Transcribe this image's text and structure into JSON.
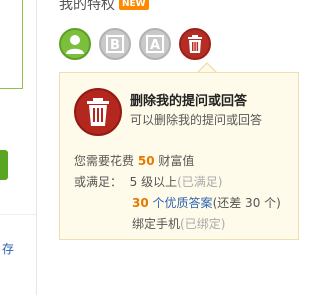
{
  "left": {
    "link_text": "存"
  },
  "section": {
    "title": "我的特权",
    "badge": "NEW"
  },
  "icons": [
    {
      "name": "user-icon"
    },
    {
      "name": "letter-b-icon",
      "letter": "B"
    },
    {
      "name": "letter-a-icon",
      "letter": "A"
    },
    {
      "name": "trash-icon"
    }
  ],
  "tooltip": {
    "title": "删除我的提问或回答",
    "desc": "可以删除我的提问或回答",
    "cost_prefix": "您需要花费",
    "cost_value": "50",
    "cost_suffix": "财富值",
    "or_label": "或满足：",
    "level_req": "5 级以上",
    "level_status": "(已满足)",
    "answers_count": "30",
    "answers_mid": "个",
    "answers_link": "优质答案",
    "answers_status": "(还差 30 个)",
    "bind_phone": "绑定手机",
    "bind_status": "(已绑定)"
  },
  "colors": {
    "accent_orange": "#e57a00",
    "link_blue": "#2d64b3",
    "delete_red": "#b3271f",
    "tooltip_bg": "#fffbea"
  }
}
